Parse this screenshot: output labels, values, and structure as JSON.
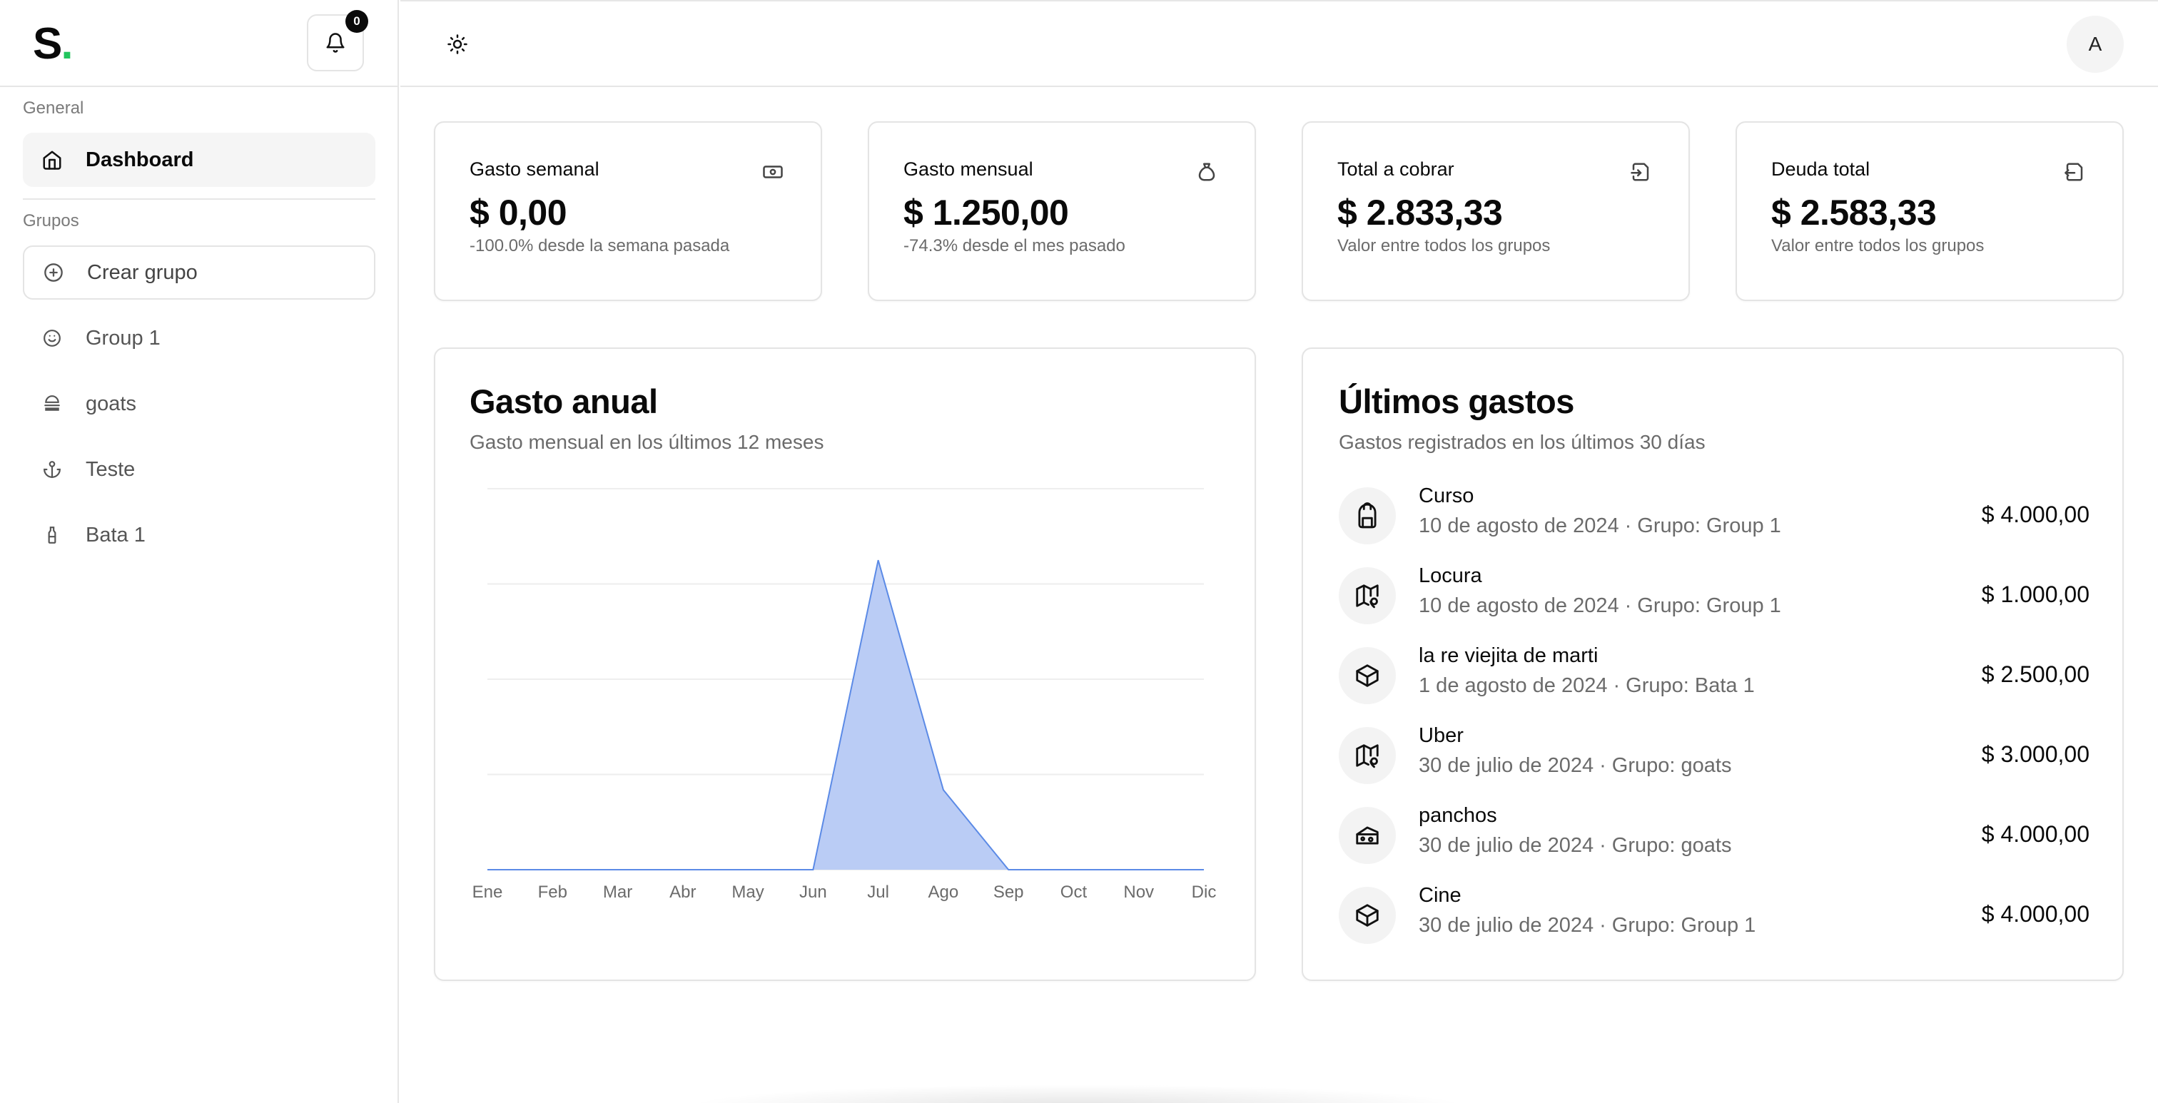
{
  "app": {
    "logo_letter": "S",
    "logo_dot": ".",
    "notifications_count": "0",
    "avatar_initial": "A"
  },
  "sidebar": {
    "general_label": "General",
    "dashboard_label": "Dashboard",
    "groups_label": "Grupos",
    "create_group_label": "Crear grupo",
    "groups": [
      {
        "label": "Group 1",
        "icon": "smile-icon"
      },
      {
        "label": "goats",
        "icon": "burger-icon"
      },
      {
        "label": "Teste",
        "icon": "anchor-icon"
      },
      {
        "label": "Bata 1",
        "icon": "bottle-icon"
      }
    ]
  },
  "stats": [
    {
      "title": "Gasto semanal",
      "value": "$ 0,00",
      "sub": "-100.0% desde la semana pasada",
      "icon": "banknote-icon"
    },
    {
      "title": "Gasto mensual",
      "value": "$ 1.250,00",
      "sub": "-74.3% desde el mes pasado",
      "icon": "money-bag-icon"
    },
    {
      "title": "Total a cobrar",
      "value": "$ 2.833,33",
      "sub": "Valor entre todos los grupos",
      "icon": "import-icon"
    },
    {
      "title": "Deuda total",
      "value": "$ 2.583,33",
      "sub": "Valor entre todos los grupos",
      "icon": "export-icon"
    }
  ],
  "annual": {
    "title": "Gasto anual",
    "subtitle": "Gasto mensual en los últimos 12 meses"
  },
  "chart_data": {
    "type": "area",
    "categories": [
      "Ene",
      "Feb",
      "Mar",
      "Abr",
      "May",
      "Jun",
      "Jul",
      "Ago",
      "Sep",
      "Oct",
      "Nov",
      "Dic"
    ],
    "values": [
      0,
      0,
      0,
      0,
      0,
      0,
      13000,
      3350,
      0,
      0,
      0,
      0
    ],
    "ylim": [
      0,
      16000
    ],
    "grid": true,
    "color": "#b6c9f4",
    "line_color": "#5b8ae6"
  },
  "recent": {
    "title": "Últimos gastos",
    "subtitle": "Gastos registrados en los últimos 30 días",
    "items": [
      {
        "name": "Curso",
        "date": "10 de agosto de 2024",
        "group": "Grupo: Group 1",
        "amount": "$ 4.000,00",
        "icon": "backpack-icon"
      },
      {
        "name": "Locura",
        "date": "10 de agosto de 2024",
        "group": "Grupo: Group 1",
        "amount": "$ 1.000,00",
        "icon": "map-pin-icon"
      },
      {
        "name": "la re viejita de marti",
        "date": "1 de agosto de 2024",
        "group": "Grupo: Bata 1",
        "amount": "$ 2.500,00",
        "icon": "box-icon"
      },
      {
        "name": "Uber",
        "date": "30 de julio de 2024",
        "group": "Grupo: goats",
        "amount": "$ 3.000,00",
        "icon": "map-pin-icon"
      },
      {
        "name": "panchos",
        "date": "30 de julio de 2024",
        "group": "Grupo: goats",
        "amount": "$ 4.000,00",
        "icon": "cheese-icon"
      },
      {
        "name": "Cine",
        "date": "30 de julio de 2024",
        "group": "Grupo: Group 1",
        "amount": "$ 4.000,00",
        "icon": "box-icon"
      }
    ]
  }
}
